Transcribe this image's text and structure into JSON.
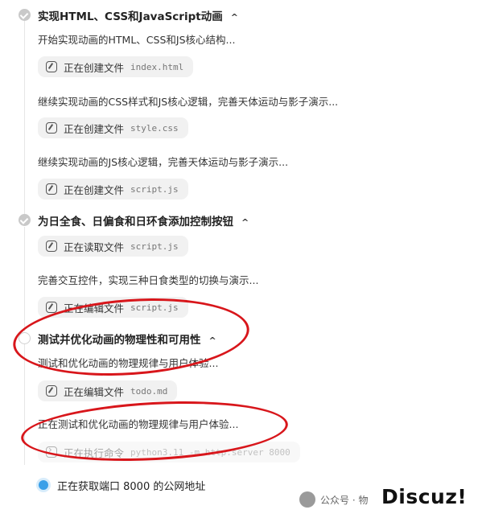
{
  "steps": [
    {
      "title": "实现HTML、CSS和JavaScript动画",
      "chevron": "^",
      "state": "done",
      "items": [
        {
          "desc": "开始实现动画的HTML、CSS和JS核心结构..."
        },
        {
          "action": "正在创建文件",
          "file": "index.html",
          "icon": "pencil-icon"
        },
        {
          "desc": "继续实现动画的CSS样式和JS核心逻辑，完善天体运动与影子演示..."
        },
        {
          "action": "正在创建文件",
          "file": "style.css",
          "icon": "pencil-icon"
        },
        {
          "desc": "继续实现动画的JS核心逻辑，完善天体运动与影子演示..."
        },
        {
          "action": "正在创建文件",
          "file": "script.js",
          "icon": "pencil-icon"
        }
      ]
    },
    {
      "title": "为日全食、日偏食和日环食添加控制按钮",
      "chevron": "^",
      "state": "done",
      "items": [
        {
          "action": "正在读取文件",
          "file": "script.js",
          "icon": "pencil-icon"
        },
        {
          "desc": "完善交互控件，实现三种日食类型的切换与演示..."
        },
        {
          "action": "正在编辑文件",
          "file": "script.js",
          "icon": "pencil-icon"
        }
      ]
    },
    {
      "title": "测试并优化动画的物理性和可用性",
      "chevron": "^",
      "state": "active",
      "items": [
        {
          "desc": "测试和优化动画的物理规律与用户体验..."
        },
        {
          "action": "正在编辑文件",
          "file": "todo.md",
          "icon": "pencil-icon"
        },
        {
          "desc": "正在测试和优化动画的物理规律与用户体验..."
        },
        {
          "action": "正在执行命令",
          "file": "python3.11 -m http.server 8000",
          "icon": "terminal-icon"
        }
      ]
    }
  ],
  "status": {
    "text": "正在获取端口 8000 的公网地址",
    "color": "#3aa0e8"
  },
  "watermark": {
    "source": "公众号 · 物",
    "brand": "Discuz!"
  },
  "annotation_color": "#d8161b"
}
